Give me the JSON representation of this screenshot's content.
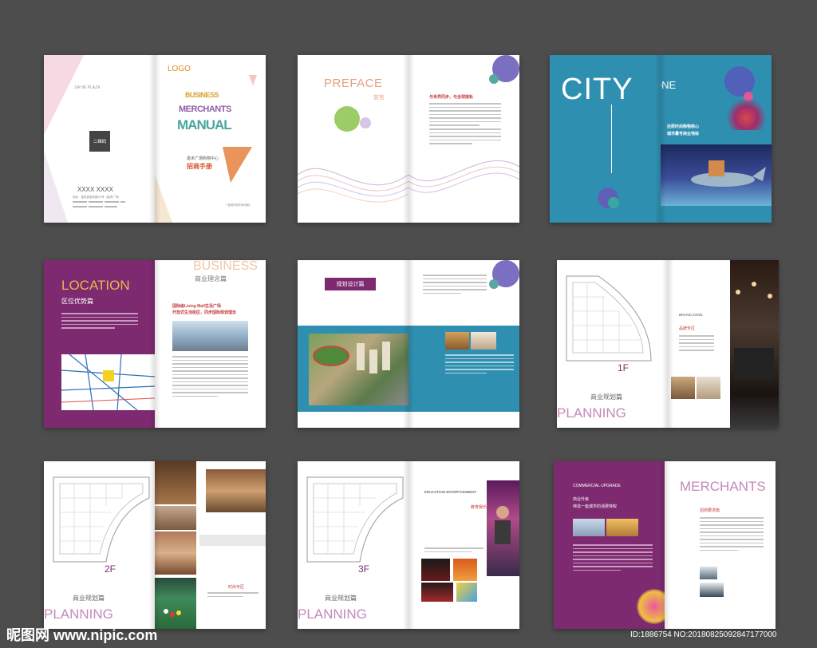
{
  "s1": {
    "plaza": "JIA HE PLAZA",
    "qr": "二维码",
    "phone": "XXXX XXXX",
    "address": "地址：嘉禾县嘉禾路XX号（嘉禾广场）",
    "logo": "LOGO",
    "w1": "BUSINESS",
    "w2": "MERCHANTS",
    "w3": "MANUAL",
    "sub": "嘉禾广场购物中心",
    "title": "招商手册",
    "foot": "一座城市的时尚地标"
  },
  "s2": {
    "preface": "PREFACE",
    "preface_cn": "前言",
    "headline": "与世界同步，与全球接轨"
  },
  "s3": {
    "city": "CITY",
    "one": "ONE",
    "line1": "还原时尚购物核心",
    "line2": "城市量号商业地标"
  },
  "s4": {
    "location": "LOCATION",
    "location_cn": "区位优势篇",
    "business": "BUSINESS",
    "business_cn": "商业理念篇",
    "headline1": "国际级Living Mall生活广场",
    "headline2": "开放式生活街区，同步国际规划理念"
  },
  "s5": {
    "badge": "规划设计篇"
  },
  "s6": {
    "floor": "1F",
    "brand_zone": "BRAND ZONE",
    "brand_cn": "品牌专区",
    "planning_cn": "商业规划篇",
    "planning": "PLANNING"
  },
  "s7": {
    "floor": "2F",
    "planning_cn": "商业规划篇",
    "planning": "PLANNING",
    "zone": "时尚专区"
  },
  "s8": {
    "floor": "3F",
    "edu": "EDUCATION ENTERTAINMENT",
    "edu_cn": "教育娱乐",
    "planning_cn": "商业规划篇",
    "planning": "PLANNING"
  },
  "s9": {
    "upgrade": "COMMERCIAL UPGRADE",
    "upgrade_cn": "商业升级",
    "upgrade_sub": "缔造一座城市的消费特权",
    "merchants": "MERCHANTS",
    "merchants_cn": "招商要求篇"
  },
  "watermark": {
    "left": "昵图网 www.nipic.com",
    "right": "ID:1886754 NO:20180825092847177000"
  }
}
